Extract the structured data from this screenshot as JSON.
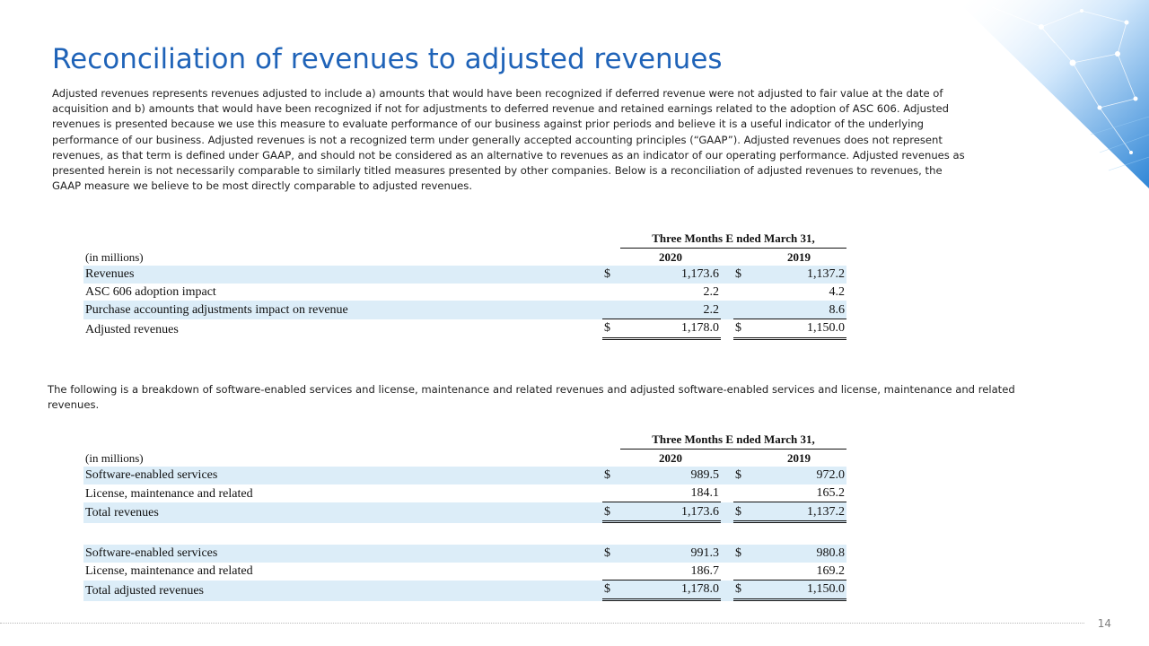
{
  "title": "Reconciliation of revenues to adjusted revenues",
  "intro": "Adjusted revenues represents revenues adjusted to include a) amounts that would have been recognized if deferred revenue were not adjusted to fair value at the date of acquisition and b) amounts that would have been recognized if not for adjustments to deferred revenue and retained earnings related to the adoption of ASC 606.  Adjusted revenues is presented because we use this measure to evaluate performance of our business against prior periods and believe it is a useful indicator of the underlying performance of our business.  Adjusted revenues is not a recognized term under generally accepted accounting principles (“GAAP”).  Adjusted revenues does not represent revenues, as that term is defined under GAAP, and should not be considered as an alternative to revenues as an indicator of our operating performance.  Adjusted revenues as presented herein is not necessarily comparable to similarly titled measures presented by other companies.  Below is a reconciliation of adjusted revenues to revenues, the GAAP measure we believe to be most directly comparable to adjusted revenues.",
  "intro2": "The following is a breakdown of software-enabled services and license, maintenance and related revenues and adjusted software-enabled services and license, maintenance and related revenues.",
  "table1": {
    "period_header": "Three Months E nded March 31,",
    "units": "(in millions)",
    "year1": "2020",
    "year2": "2019",
    "rows": [
      {
        "label": "Revenues",
        "cur": "$",
        "v1": "1,173.6",
        "v2": "1,137.2"
      },
      {
        "label": "ASC 606 adoption impact",
        "cur": "",
        "v1": "2.2",
        "v2": "4.2"
      },
      {
        "label": "Purchase accounting adjustments impact on revenue",
        "cur": "",
        "v1": "2.2",
        "v2": "8.6"
      },
      {
        "label": "Adjusted revenues",
        "cur": "$",
        "v1": "1,178.0",
        "v2": "1,150.0"
      }
    ]
  },
  "table2": {
    "period_header": "Three Months E nded March 31,",
    "units": "(in millions)",
    "year1": "2020",
    "year2": "2019",
    "rows": [
      {
        "label": "Software-enabled services",
        "cur": "$",
        "v1": "989.5",
        "v2": "972.0"
      },
      {
        "label": "License, maintenance and related",
        "cur": "",
        "v1": "184.1",
        "v2": "165.2"
      },
      {
        "label": "Total revenues",
        "cur": "$",
        "v1": "1,173.6",
        "v2": "1,137.2"
      },
      {
        "label": "Software-enabled services",
        "cur": "$",
        "v1": "991.3",
        "v2": "980.8"
      },
      {
        "label": "License, maintenance and related",
        "cur": "",
        "v1": "186.7",
        "v2": "169.2"
      },
      {
        "label": "Total adjusted revenues",
        "cur": "$",
        "v1": "1,178.0",
        "v2": "1,150.0"
      }
    ]
  },
  "page_number": "14",
  "colors": {
    "title": "#1f63b8",
    "row_shade": "#dcedf8",
    "decor": "#5fa8e8"
  }
}
